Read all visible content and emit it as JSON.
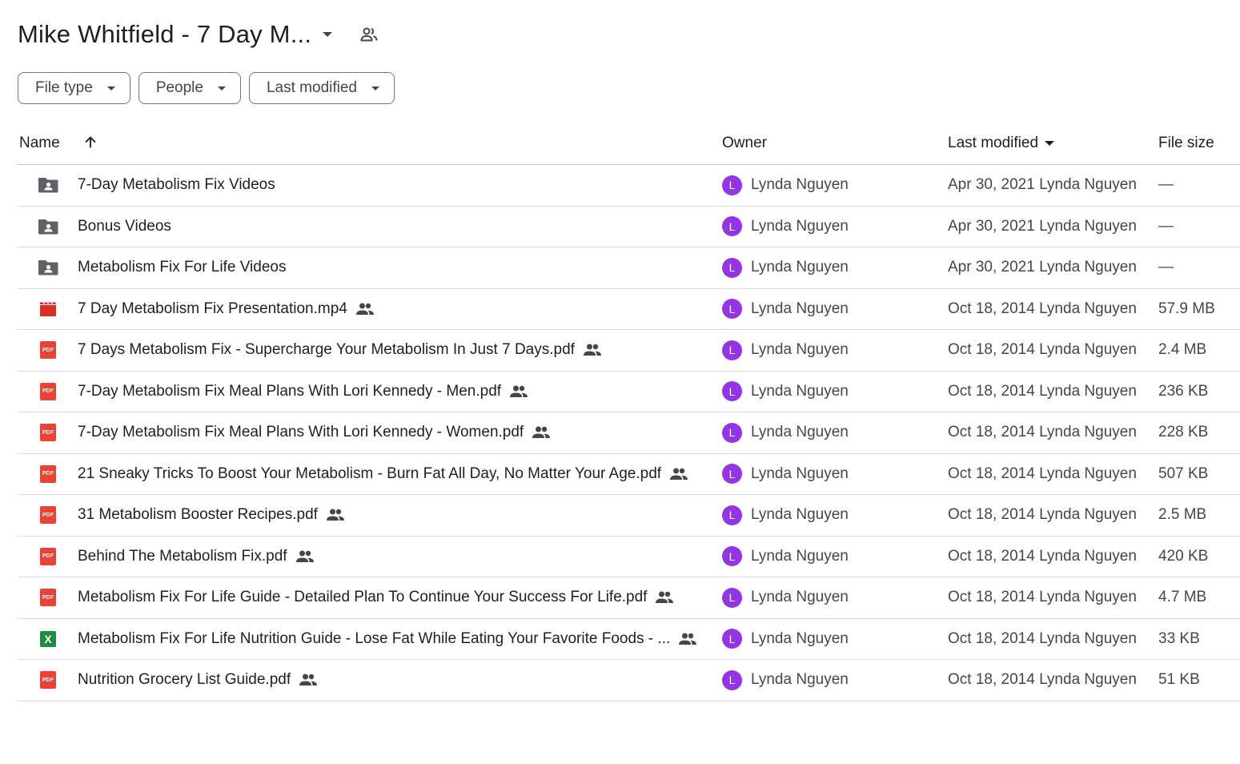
{
  "header": {
    "title": "Mike Whitfield - 7 Day M...",
    "title_icon": "chevron-down-icon",
    "shared_icon": "shared-folder-icon"
  },
  "filters": [
    {
      "label": "File type",
      "icon": "dropdown-icon"
    },
    {
      "label": "People",
      "icon": "dropdown-icon"
    },
    {
      "label": "Last modified",
      "icon": "dropdown-icon"
    }
  ],
  "table": {
    "columns": {
      "name": "Name",
      "owner": "Owner",
      "last_modified": "Last modified",
      "file_size": "File size"
    },
    "sort": {
      "column": "name",
      "direction": "ascending",
      "modified_caret": "down"
    },
    "rows": [
      {
        "icon": "shared-folder-icon",
        "name": "7-Day Metabolism Fix Videos",
        "shared": false,
        "owner": "Lynda Nguyen",
        "avatar": "L",
        "modified": "Apr 30, 2021 Lynda Nguyen",
        "size": "—"
      },
      {
        "icon": "shared-folder-icon",
        "name": "Bonus Videos",
        "shared": false,
        "owner": "Lynda Nguyen",
        "avatar": "L",
        "modified": "Apr 30, 2021 Lynda Nguyen",
        "size": "—"
      },
      {
        "icon": "shared-folder-icon",
        "name": "Metabolism Fix For Life Videos",
        "shared": false,
        "owner": "Lynda Nguyen",
        "avatar": "L",
        "modified": "Apr 30, 2021 Lynda Nguyen",
        "size": "—"
      },
      {
        "icon": "video-icon",
        "name": "7 Day Metabolism Fix Presentation.mp4",
        "shared": true,
        "owner": "Lynda Nguyen",
        "avatar": "L",
        "modified": "Oct 18, 2014 Lynda Nguyen",
        "size": "57.9 MB"
      },
      {
        "icon": "pdf-icon",
        "name": "7 Days Metabolism Fix - Supercharge Your Metabolism In Just 7 Days.pdf",
        "shared": true,
        "owner": "Lynda Nguyen",
        "avatar": "L",
        "modified": "Oct 18, 2014 Lynda Nguyen",
        "size": "2.4 MB"
      },
      {
        "icon": "pdf-icon",
        "name": "7-Day Metabolism Fix Meal Plans With Lori Kennedy - Men.pdf",
        "shared": true,
        "owner": "Lynda Nguyen",
        "avatar": "L",
        "modified": "Oct 18, 2014 Lynda Nguyen",
        "size": "236 KB"
      },
      {
        "icon": "pdf-icon",
        "name": "7-Day Metabolism Fix Meal Plans With Lori Kennedy - Women.pdf",
        "shared": true,
        "owner": "Lynda Nguyen",
        "avatar": "L",
        "modified": "Oct 18, 2014 Lynda Nguyen",
        "size": "228 KB"
      },
      {
        "icon": "pdf-icon",
        "name": "21 Sneaky Tricks To Boost Your Metabolism - Burn Fat All Day, No Matter Your Age.pdf",
        "shared": true,
        "owner": "Lynda Nguyen",
        "avatar": "L",
        "modified": "Oct 18, 2014 Lynda Nguyen",
        "size": "507 KB"
      },
      {
        "icon": "pdf-icon",
        "name": "31 Metabolism Booster Recipes.pdf",
        "shared": true,
        "owner": "Lynda Nguyen",
        "avatar": "L",
        "modified": "Oct 18, 2014 Lynda Nguyen",
        "size": "2.5 MB"
      },
      {
        "icon": "pdf-icon",
        "name": "Behind The Metabolism Fix.pdf",
        "shared": true,
        "owner": "Lynda Nguyen",
        "avatar": "L",
        "modified": "Oct 18, 2014 Lynda Nguyen",
        "size": "420 KB"
      },
      {
        "icon": "pdf-icon",
        "name": "Metabolism Fix For Life Guide - Detailed Plan To Continue Your Success For Life.pdf",
        "shared": true,
        "owner": "Lynda Nguyen",
        "avatar": "L",
        "modified": "Oct 18, 2014 Lynda Nguyen",
        "size": "4.7 MB"
      },
      {
        "icon": "sheets-icon",
        "name": "Metabolism Fix For Life Nutrition Guide - Lose Fat While Eating Your Favorite Foods - ...",
        "shared": true,
        "owner": "Lynda Nguyen",
        "avatar": "L",
        "modified": "Oct 18, 2014 Lynda Nguyen",
        "size": "33 KB"
      },
      {
        "icon": "pdf-icon",
        "name": "Nutrition Grocery List Guide.pdf",
        "shared": true,
        "owner": "Lynda Nguyen",
        "avatar": "L",
        "modified": "Oct 18, 2014 Lynda Nguyen",
        "size": "51 KB"
      }
    ]
  },
  "colors": {
    "avatar": "#9334e6",
    "pdf": "#ea4335",
    "video": "#d93025",
    "sheets": "#1e8e3e",
    "folder": "#5f6368"
  }
}
